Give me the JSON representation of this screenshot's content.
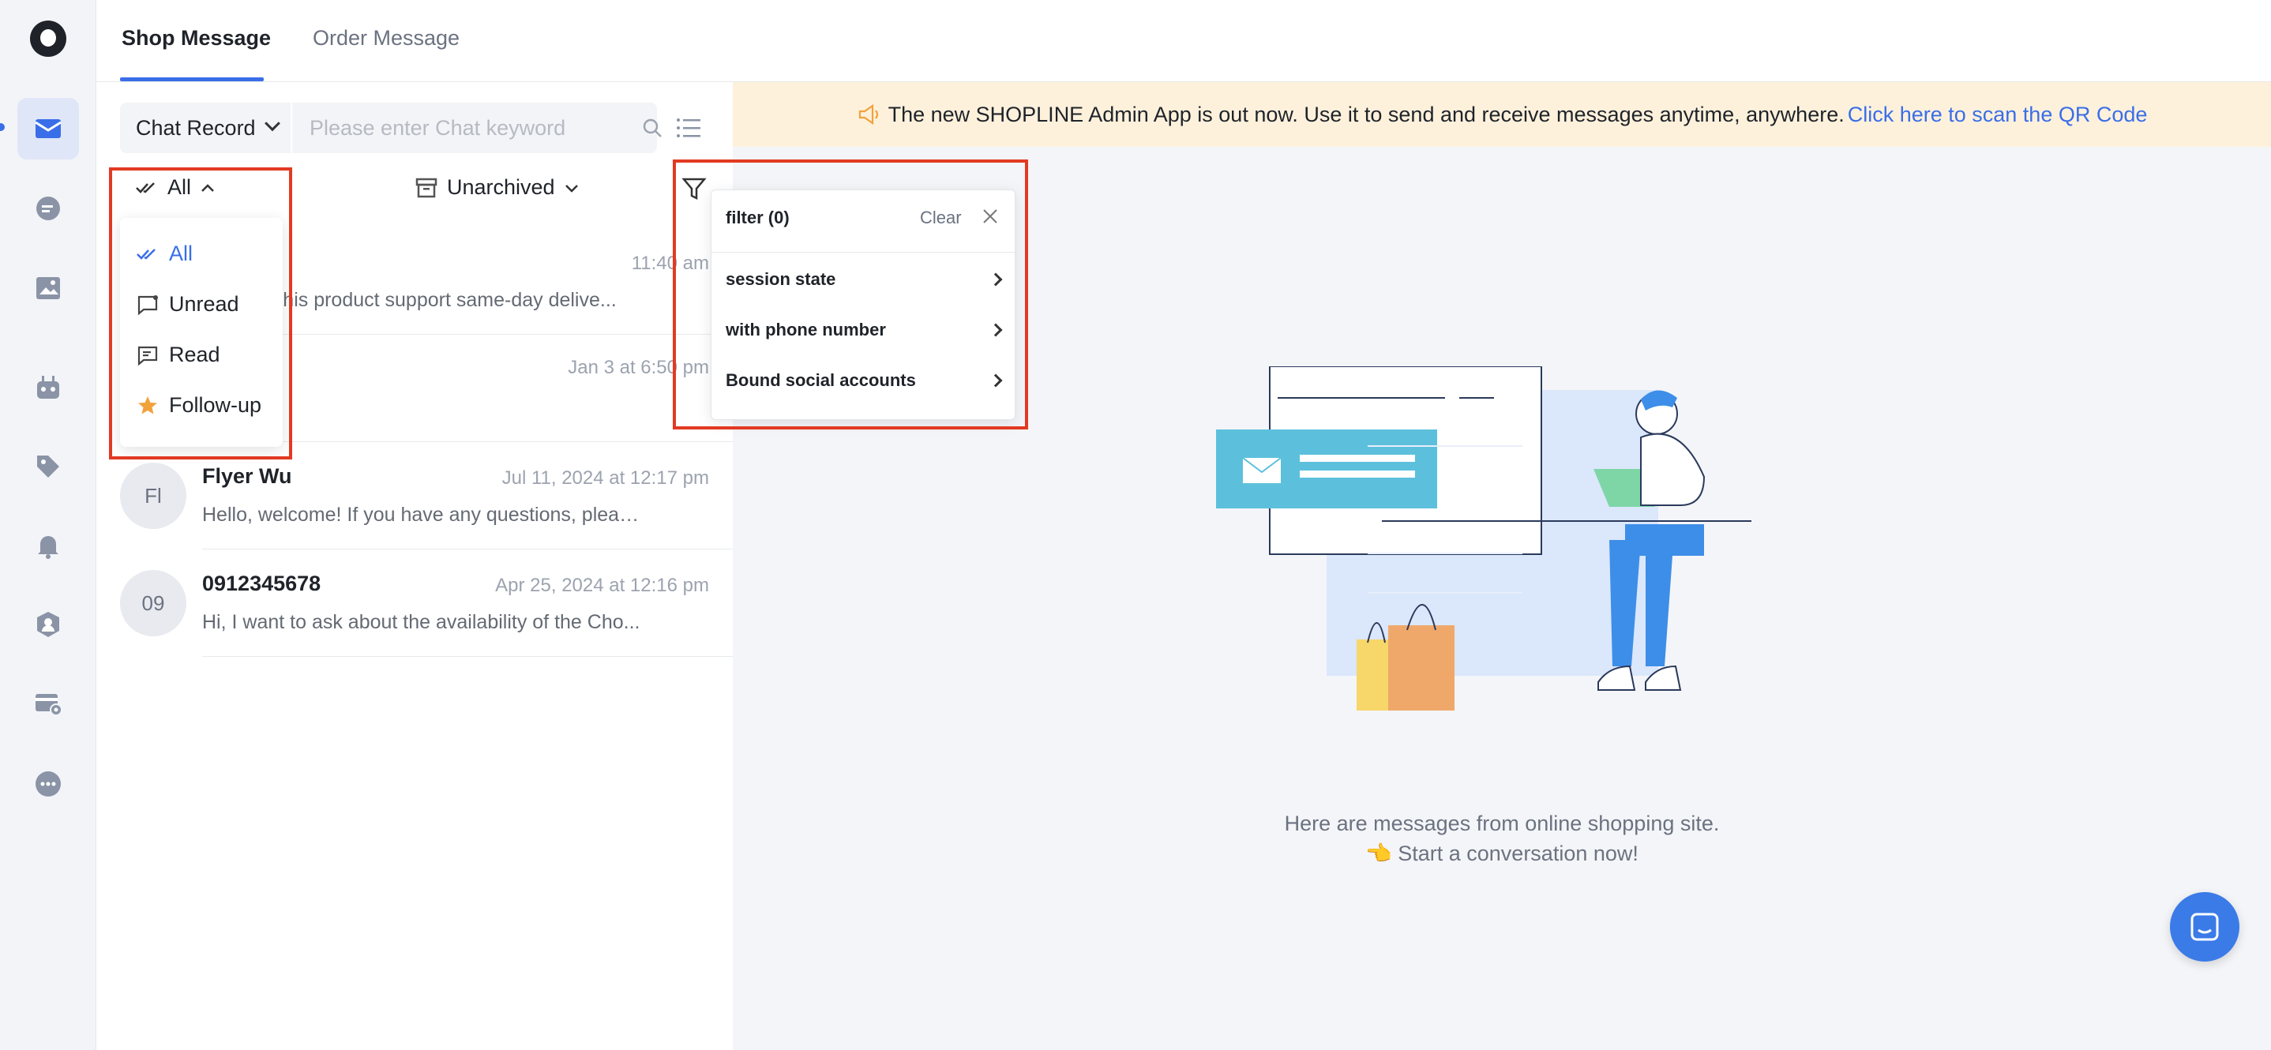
{
  "sidebar": {
    "items": [
      {
        "icon": "mail-icon",
        "active": true
      },
      {
        "icon": "chat-bubble-icon"
      },
      {
        "icon": "image-icon"
      },
      {
        "icon": "robot-icon"
      },
      {
        "icon": "tag-icon"
      },
      {
        "icon": "bell-icon"
      },
      {
        "icon": "user-shield-icon"
      },
      {
        "icon": "card-settings-icon"
      },
      {
        "icon": "more-icon"
      }
    ]
  },
  "tabs": [
    {
      "label": "Shop Message",
      "active": true
    },
    {
      "label": "Order Message"
    }
  ],
  "search": {
    "type_label": "Chat Record",
    "placeholder": "Please enter Chat keyword"
  },
  "filters": {
    "read_label": "All",
    "archive_label": "Unarchived"
  },
  "read_dropdown": {
    "items": [
      {
        "label": "All",
        "icon": "double-check-icon",
        "selected": true
      },
      {
        "label": "Unread",
        "icon": "unread-icon"
      },
      {
        "label": "Read",
        "icon": "read-icon"
      },
      {
        "label": "Follow-up",
        "icon": "star-icon"
      }
    ]
  },
  "filter_popover": {
    "title": "filter (0)",
    "clear_label": "Clear",
    "rows": [
      "session state",
      "with phone number",
      "Bound social accounts"
    ]
  },
  "conversations": [
    {
      "avatar": "",
      "name": "",
      "time": "11:40 am",
      "snippet": "es this product support same-day delive..."
    },
    {
      "avatar": "",
      "name": "",
      "time": "Jan 3 at 6:50 pm",
      "snippet": ""
    },
    {
      "avatar": "Fl",
      "name": "Flyer Wu",
      "time": "Jul 11, 2024 at 12:17 pm",
      "snippet": "Hello, welcome! If you have any questions, please..."
    },
    {
      "avatar": "09",
      "name": "0912345678",
      "time": "Apr 25, 2024 at 12:16 pm",
      "snippet": "Hi, I want to ask about the availability of the Cho..."
    }
  ],
  "banner": {
    "text": "The new SHOPLINE Admin App is out now. Use it to send and receive messages anytime, anywhere.",
    "link": "Click here to scan the QR Code"
  },
  "empty_state": {
    "line1": "Here are messages from online shopping site.",
    "line2": "👈 Start a conversation now!"
  },
  "colors": {
    "accent": "#3a6ee8",
    "highlight": "#e23a22",
    "banner_bg": "#fdf1dc"
  }
}
